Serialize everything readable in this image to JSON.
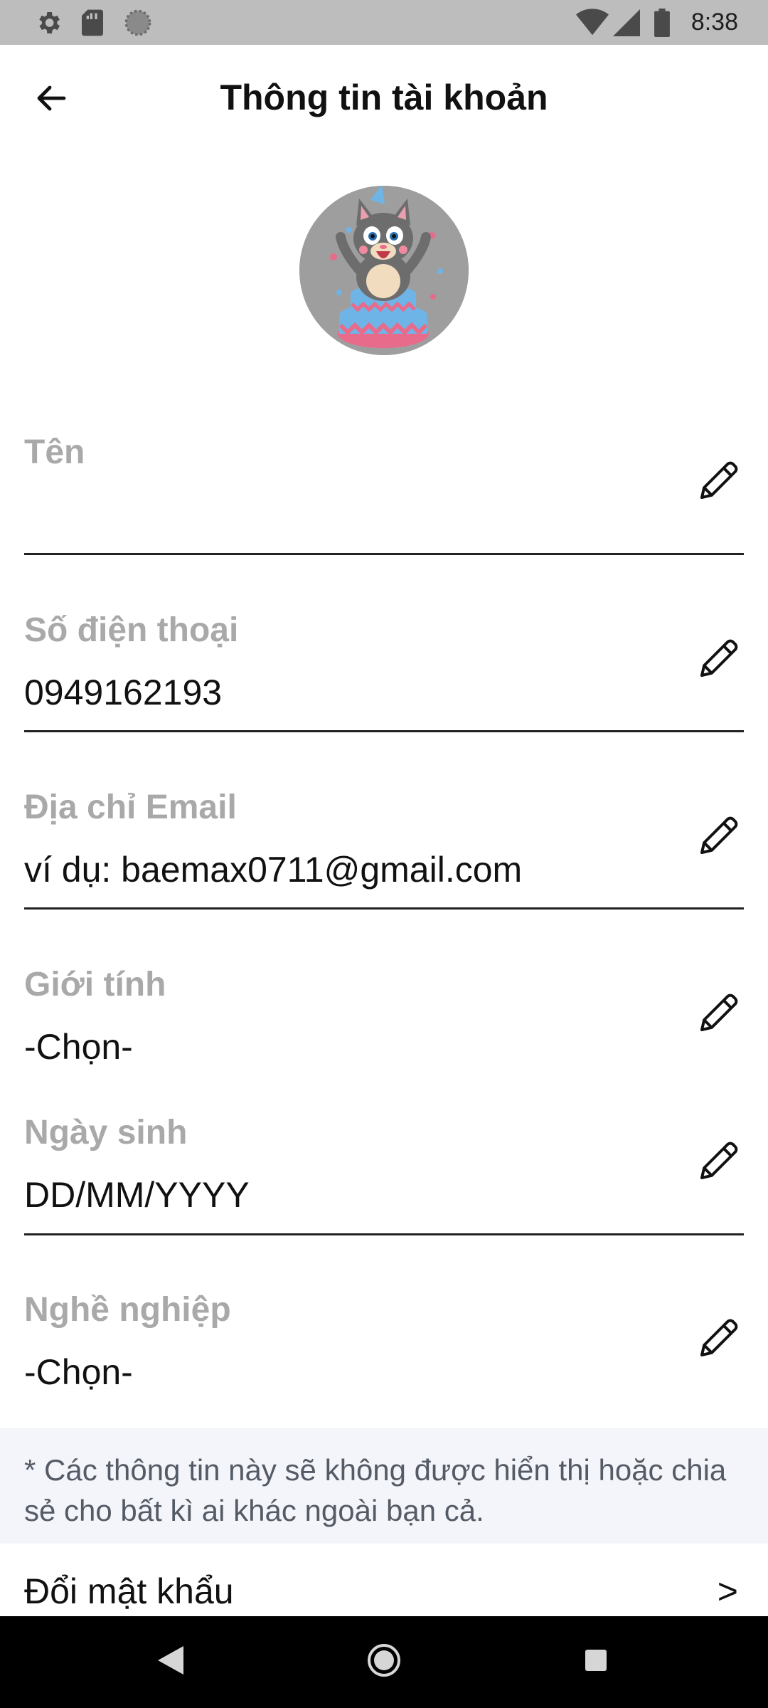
{
  "status_bar": {
    "time": "8:38",
    "icons": [
      "gear-icon",
      "sd-card-icon",
      "loading-circle-icon",
      "wifi-icon",
      "cell-signal-icon",
      "battery-icon"
    ]
  },
  "header": {
    "title": "Thông tin tài khoản",
    "back_icon": "arrow-left-icon"
  },
  "fields": {
    "name": {
      "label": "Tên",
      "value": ""
    },
    "phone": {
      "label": "Số điện thoại",
      "value": "0949162193"
    },
    "email": {
      "label": "Địa chỉ Email",
      "placeholder": "ví dụ: baemax0711@gmail.com"
    },
    "gender": {
      "label": "Giới tính",
      "value": "-Chọn-"
    },
    "birthday": {
      "label": "Ngày sinh",
      "placeholder": "DD/MM/YYYY"
    },
    "job": {
      "label": "Nghề nghiệp",
      "value": "-Chọn-"
    }
  },
  "note": "* Các thông tin này sẽ không được hiển thị hoặc chia sẻ cho bất kì ai khác ngoài bạn cả.",
  "change_password": {
    "label": "Đổi mật khẩu",
    "chevron": ">"
  },
  "colors": {
    "status_bar_bg": "#bdbdbd",
    "label_gray": "#a9a9a9",
    "note_bg": "#f3f5fa",
    "nav_bar_bg": "#000000"
  }
}
